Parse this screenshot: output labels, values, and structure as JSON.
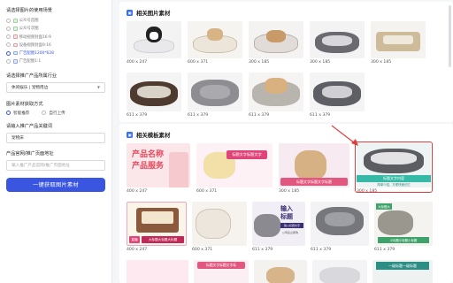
{
  "sidebar": {
    "usage_label": "请选择图片的使用场景",
    "usage_options": [
      {
        "label": "公众号首图",
        "checked": false
      },
      {
        "label": "公众号次图",
        "checked": false
      },
      {
        "label": "移动视频封面16:9",
        "checked": false
      },
      {
        "label": "设备视频封面9:16",
        "checked": false
      },
      {
        "label": "广告配图1200*628",
        "checked": true
      },
      {
        "label": "广告配图1:1",
        "checked": false
      }
    ],
    "industry_label": "请选择推广产品所属行业",
    "industry_value": "休闲娱乐 | 宠物周边",
    "source_label": "图片素材获取方式",
    "source_options": [
      {
        "label": "智能推荐",
        "checked": true
      },
      {
        "label": "自行上传",
        "checked": false
      }
    ],
    "keyword_label": "请输入推广产品关键词",
    "keyword_value": "宠物床",
    "url_label": "产品官网/推广页面地址",
    "url_placeholder": "输入推广产品官网/推广页面地址",
    "submit_label": "一键获取图片素材"
  },
  "main": {
    "section_images_title": "相关图片素材",
    "section_templates_title": "相关模板素材",
    "image_sizes_row1": [
      "400 x 247",
      "600 x 371",
      "300 x 185",
      "300 x 185",
      "300 x 185"
    ],
    "image_sizes_row2": [
      "611 x 379",
      "611 x 379",
      "611 x 379",
      "611 x 379"
    ],
    "template_sizes_row1": [
      "400 x 247",
      "600 x 371",
      "300 x 185",
      "300 x 185"
    ],
    "template_sizes_row2": [
      "400 x 247",
      "600 x 371",
      "611 x 379",
      "611 x 379",
      "611 x 379"
    ],
    "template_texts": {
      "t1_line1": "产品名称",
      "t1_line2": "产品服务",
      "t2_caption": "标题文字标题文字",
      "t3_caption": "标题文字标题文字标题",
      "t4_banner": "标题文字内容",
      "t4_sub": "简单介绍，方便快速记忆",
      "t5_badge": "直播",
      "t5_caption": "大标题大标题大标题",
      "t6_line1": "输入",
      "t6_line2": "标题",
      "t6_tag": "输入标题文字",
      "t6_sub": "公司名立即购",
      "t7_tag": "大标题大",
      "t7_caption": "小标题小标题小标题",
      "t8_caption": "标题文字标题文字标",
      "t9_caption": "一级标题一级标题"
    }
  }
}
